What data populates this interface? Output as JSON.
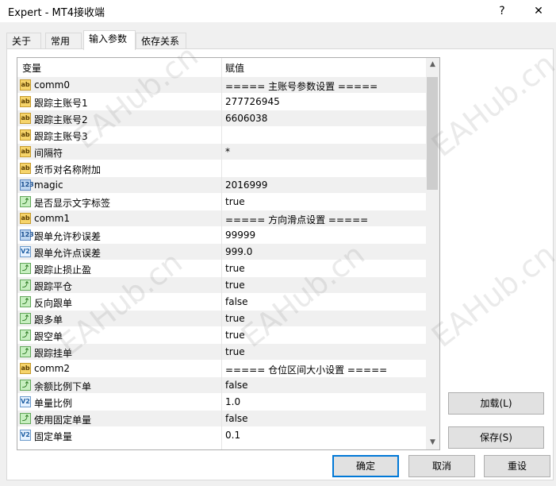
{
  "window": {
    "title": "Expert - MT4接收端",
    "help_label": "?",
    "close_label": "✕"
  },
  "tabs": [
    "关于",
    "常用",
    "输入参数",
    "依存关系"
  ],
  "active_tab": 2,
  "grid": {
    "headers": {
      "variable": "变量",
      "value": "赋值"
    },
    "rows": [
      {
        "icon": "ab",
        "name": "comm0",
        "value": "===== 主账号参数设置 ====="
      },
      {
        "icon": "ab",
        "name": "跟踪主账号1",
        "value": "277726945"
      },
      {
        "icon": "ab",
        "name": "跟踪主账号2",
        "value": "6606038"
      },
      {
        "icon": "ab",
        "name": "跟踪主账号3",
        "value": ""
      },
      {
        "icon": "ab",
        "name": "间隔符",
        "value": "*"
      },
      {
        "icon": "ab",
        "name": "货币对名称附加",
        "value": ""
      },
      {
        "icon": "123",
        "name": "magic",
        "value": "2016999"
      },
      {
        "icon": "bool",
        "name": "是否显示文字标签",
        "value": "true"
      },
      {
        "icon": "ab",
        "name": "comm1",
        "value": "===== 方向滑点设置 ====="
      },
      {
        "icon": "123",
        "name": "跟单允许秒误差",
        "value": "99999"
      },
      {
        "icon": "v2",
        "name": "跟单允许点误差",
        "value": "999.0"
      },
      {
        "icon": "bool",
        "name": "跟踪止损止盈",
        "value": "true"
      },
      {
        "icon": "bool",
        "name": "跟踪平仓",
        "value": "true"
      },
      {
        "icon": "bool",
        "name": "反向跟单",
        "value": "false"
      },
      {
        "icon": "bool",
        "name": "跟多单",
        "value": "true"
      },
      {
        "icon": "bool",
        "name": "跟空单",
        "value": "true"
      },
      {
        "icon": "bool",
        "name": "跟踪挂单",
        "value": "true"
      },
      {
        "icon": "ab",
        "name": "comm2",
        "value": "===== 仓位区间大小设置 ====="
      },
      {
        "icon": "bool",
        "name": "余额比例下单",
        "value": "false"
      },
      {
        "icon": "v2",
        "name": "单量比例",
        "value": "1.0"
      },
      {
        "icon": "bool",
        "name": "使用固定单量",
        "value": "false"
      },
      {
        "icon": "v2",
        "name": "固定单量",
        "value": "0.1"
      }
    ]
  },
  "icon_labels": {
    "ab": "ab",
    "123": "123",
    "v2": "V2",
    "bool": "⤴"
  },
  "buttons": {
    "load": "加载(L)",
    "save": "保存(S)",
    "ok": "确定",
    "cancel": "取消",
    "reset": "重设"
  },
  "watermark": "EAHub.cn",
  "colors": {
    "accent": "#0078d7",
    "row_alt": "#f0f0f0"
  }
}
